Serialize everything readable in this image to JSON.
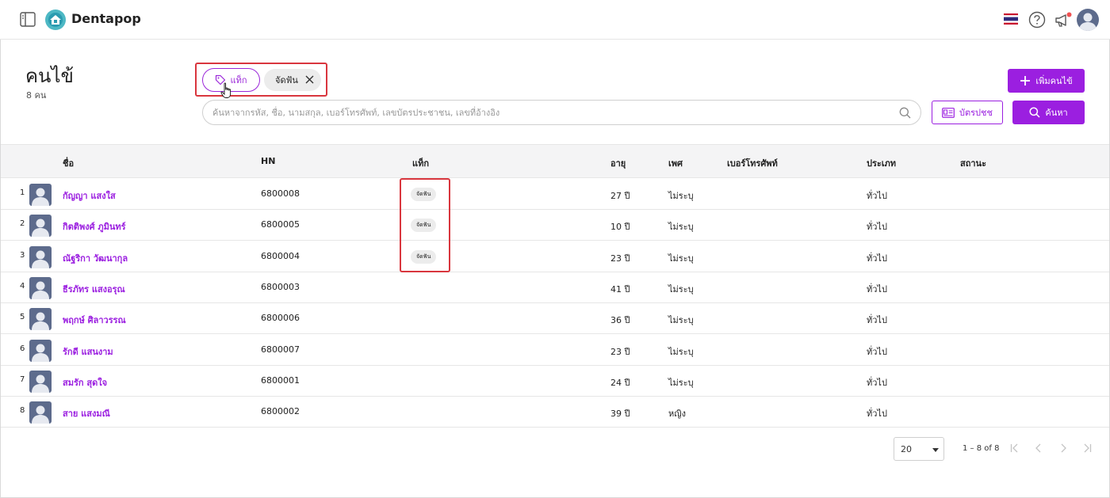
{
  "app": {
    "brand": "Dentapop"
  },
  "page": {
    "title": "คนไข้",
    "count": "8 คน"
  },
  "filters": {
    "tag_button_label": "แท็ก",
    "active_chip": "จัดฟัน"
  },
  "search": {
    "placeholder": "ค้นหาจากรหัส, ชื่อ, นามสกุล, เบอร์โทรศัพท์, เลขบัตรประชาชน, เลขที่อ้างอิง",
    "value": ""
  },
  "actions": {
    "add_label": "เพิ่มคนไข้",
    "idcard_label": "บัตรปชช",
    "search_label": "ค้นหา"
  },
  "table": {
    "headers": {
      "name": "ชื่อ",
      "hn": "HN",
      "tag": "แท็ก",
      "age": "อายุ",
      "gender": "เพศ",
      "phone": "เบอร์โทรศัพท์",
      "type": "ประเภท",
      "status": "สถานะ"
    },
    "rows": [
      {
        "idx": "1",
        "name": "กัญญา แสงใส",
        "hn": "6800008",
        "tag": "จัดฟัน",
        "age": "27 ปี",
        "gender": "ไม่ระบุ",
        "phone": "",
        "type": "ทั่วไป",
        "status": ""
      },
      {
        "idx": "2",
        "name": "กิตติพงศ์ ภูมินทร์",
        "hn": "6800005",
        "tag": "จัดฟัน",
        "age": "10 ปี",
        "gender": "ไม่ระบุ",
        "phone": "",
        "type": "ทั่วไป",
        "status": ""
      },
      {
        "idx": "3",
        "name": "ณัฐริกา วัฒนากุล",
        "hn": "6800004",
        "tag": "จัดฟัน",
        "age": "23 ปี",
        "gender": "ไม่ระบุ",
        "phone": "",
        "type": "ทั่วไป",
        "status": ""
      },
      {
        "idx": "4",
        "name": "ธีรภัทร แสงอรุณ",
        "hn": "6800003",
        "tag": "",
        "age": "41 ปี",
        "gender": "ไม่ระบุ",
        "phone": "",
        "type": "ทั่วไป",
        "status": ""
      },
      {
        "idx": "5",
        "name": "พฤกษ์ ศิลาวรรณ",
        "hn": "6800006",
        "tag": "",
        "age": "36 ปี",
        "gender": "ไม่ระบุ",
        "phone": "",
        "type": "ทั่วไป",
        "status": ""
      },
      {
        "idx": "6",
        "name": "รักดี แสนงาม",
        "hn": "6800007",
        "tag": "",
        "age": "23 ปี",
        "gender": "ไม่ระบุ",
        "phone": "",
        "type": "ทั่วไป",
        "status": ""
      },
      {
        "idx": "7",
        "name": "สมรัก สุดใจ",
        "hn": "6800001",
        "tag": "",
        "age": "24 ปี",
        "gender": "ไม่ระบุ",
        "phone": "",
        "type": "ทั่วไป",
        "status": ""
      },
      {
        "idx": "8",
        "name": "สาย แสงมณี",
        "hn": "6800002",
        "tag": "",
        "age": "39 ปี",
        "gender": "หญิง",
        "phone": "",
        "type": "ทั่วไป",
        "status": ""
      }
    ]
  },
  "pagination": {
    "page_size": "20",
    "range": "1 – 8 of 8"
  },
  "colors": {
    "accent": "#9b1fe0",
    "highlight": "#d9363e",
    "header_bg": "#f4f4f5"
  },
  "icons": [
    "sidebar-toggle-icon",
    "logo-icon",
    "thai-flag-icon",
    "help-icon",
    "megaphone-icon",
    "tag-icon",
    "close-icon",
    "search-icon",
    "plus-icon",
    "id-card-icon",
    "user-avatar-icon",
    "first-page-icon",
    "prev-page-icon",
    "next-page-icon",
    "last-page-icon"
  ]
}
